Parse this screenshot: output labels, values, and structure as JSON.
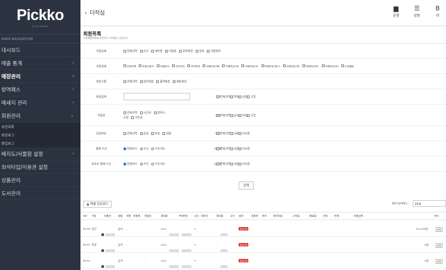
{
  "sidebar": {
    "logo": "Pickko",
    "logo_sub": "PARTNERS",
    "nav_header": "MAIN NAVIGATION",
    "items": [
      {
        "label": "대시보드",
        "chevron": ""
      },
      {
        "label": "매출 통계",
        "chevron": "›"
      },
      {
        "label": "매장관리",
        "chevron": "›"
      },
      {
        "label": "방역패스",
        "chevron": "›"
      },
      {
        "label": "메세지 관리",
        "chevron": "›"
      },
      {
        "label": "회원관리",
        "chevron": "⌄"
      }
    ],
    "subitems": [
      "회원목록",
      "회원로그",
      "출입로그"
    ],
    "items2": [
      {
        "label": "배지도/사물함 설정",
        "chevron": "›"
      },
      {
        "label": "좌석타입/이용권 설정",
        "chevron": ""
      },
      {
        "label": "상품관리",
        "chevron": ""
      },
      {
        "label": "도서관리",
        "chevron": ""
      }
    ]
  },
  "topbar": {
    "back_glyph": "‹",
    "title": "더작심",
    "icons": [
      {
        "glyph": "▆",
        "label": "운영",
        "icon": "book-icon"
      },
      {
        "glyph": "☰",
        "label": "설정",
        "icon": "settings-icon"
      },
      {
        "glyph": "B",
        "label": "바",
        "icon": "b-icon"
      }
    ]
  },
  "page": {
    "title": "회원목록",
    "desc": "전체회원목록을 확인하고 관리할수 있습니다."
  },
  "filters": {
    "status_label": "이용상태",
    "status_opts": [
      "전체선택",
      "신규",
      "재이용",
      "이용중",
      "휴면회원",
      "휴회",
      "이용완료"
    ],
    "ticket_label": "이용권쇄",
    "ticket_opts": [
      "전체선택",
      "카페고정석",
      "카페유석",
      "관리자석",
      "프리미어",
      "카페자유석B",
      "카페자유석A",
      "카페자유석C",
      "카페자유석B-2",
      "카페자유석E",
      "카페자유석F",
      "카페자유석G",
      "노부월정"
    ],
    "group_label": "회원그룹",
    "group_opts": [
      "전체선택",
      "일반회원",
      "블랙회원",
      "제한회원"
    ],
    "search_label": "회원검색",
    "age_label": "구분",
    "age_opts": [
      "전체선택",
      "학생",
      "성인",
      "무응"
    ],
    "method_label": "이용권",
    "method_opts": [
      "전체선택",
      "시간권",
      "정액시간권",
      "기간권"
    ],
    "gender_label": "성별",
    "gender_opts": [
      "전체선택",
      "남자",
      "여자",
      "무응"
    ],
    "entry_label": "입실여부",
    "entry_opts": [
      "전체선택",
      "입실",
      "퇴실",
      "외출"
    ],
    "locker_label": "좌석",
    "locker_opts": [
      "전체선택",
      "사용",
      "미사용"
    ],
    "pay_label": "결제 수신",
    "pay_opts": [
      "전체보기",
      "수신",
      "수신거부"
    ],
    "cabinet_label": "사물함",
    "cabinet_opts": [
      "전체선택",
      "사용",
      "미사용"
    ],
    "guardian_label": "보호자 결제 수신",
    "guardian_opts": [
      "전체보기",
      "수신",
      "수신거부"
    ],
    "seat_label": "신발장",
    "seat_opts": [
      "전체선택",
      "사용",
      "미사용"
    ],
    "search_btn": "검색"
  },
  "table": {
    "excel_btn": "엑셀 다운로드",
    "perpage_label": "페이지당목록수 :",
    "perpage_value": "20개",
    "headers": [
      "NO",
      "구분",
      "이용권",
      "성별",
      "지원",
      "이동형",
      "신발장",
      "휴대폰",
      "PIN번호",
      "수신",
      "보호자",
      "휴대폰",
      "수신",
      "상태",
      "이용권",
      "좌석",
      "좌석타입",
      "시작일",
      "종료일",
      "잔여",
      "잔체",
      "이용금액",
      "관리"
    ],
    "rows": [
      {
        "no": "6576",
        "type": "성인",
        "gender": "남자",
        "phone": "010-",
        "sms": "Y",
        "state": "신규",
        "badge": "회원삭제",
        "amount": "30,000원",
        "action": "관리"
      },
      {
        "no": "6575",
        "type": "학생",
        "gender": "남자",
        "phone": "010-",
        "sms": "Y",
        "state": "신규",
        "badge": "회원삭제",
        "amount": "0원",
        "action": "관리"
      },
      {
        "no": "6574",
        "type": "-",
        "gender": "남자",
        "phone": "010-",
        "sms": "Y",
        "state": "신규",
        "badge": "회원삭제",
        "amount": "0원",
        "action": "관리"
      }
    ]
  }
}
